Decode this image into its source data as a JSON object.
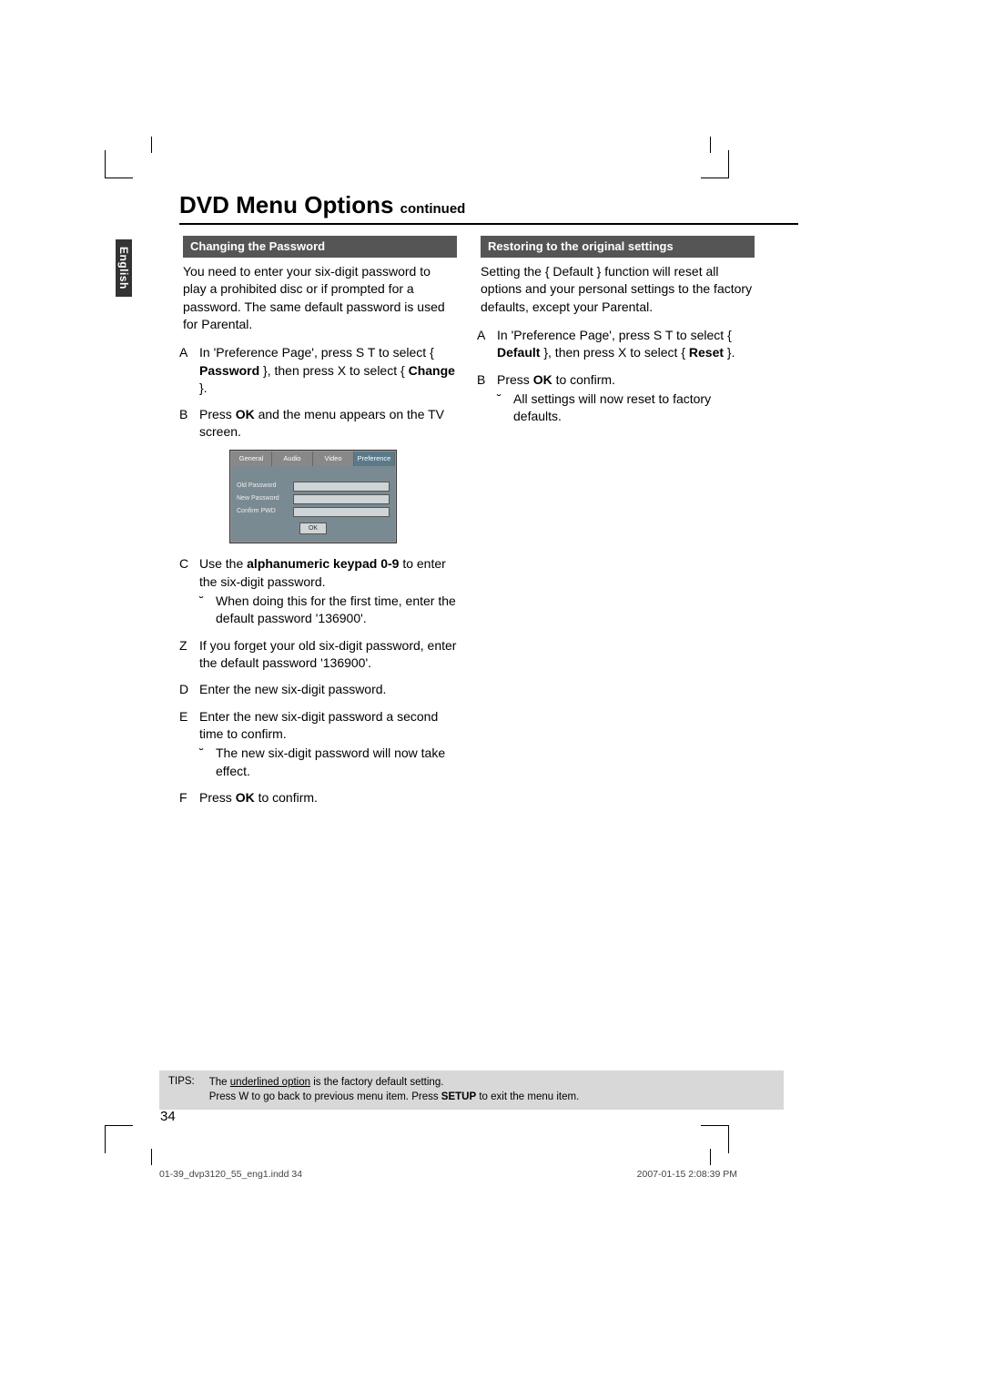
{
  "lang_tab": "English",
  "title_main": "DVD Menu Options",
  "title_sub": "continued",
  "left": {
    "section": "Changing the Password",
    "intro": "You need to enter your six-digit password to play a prohibited disc or if prompted for a password. The same default password is used for Parental.",
    "stepA_pre": "In 'Preference Page', press  S  T  to select { ",
    "stepA_pw": "Password",
    "stepA_mid": " }, then press  X to select { ",
    "stepA_ch": "Change",
    "stepA_post": " }.",
    "stepB_pre": "Press ",
    "stepB_ok": "OK",
    "stepB_post": " and the menu appears on the TV screen.",
    "osd_tabs": {
      "t1": "General",
      "t2": "Audio",
      "t3": "Video",
      "t4": "Preference"
    },
    "osd_rows": {
      "r1": "Old Password",
      "r2": "New Password",
      "r3": "Confirm PWD"
    },
    "osd_ok": "OK",
    "stepC_pre": "Use the ",
    "stepC_bold": "alphanumeric keypad 0-9",
    "stepC_post": " to enter the six-digit password.",
    "stepC_sub": "When doing this for the first time, enter the default password '136900'.",
    "stepZ": "If you forget your old six-digit password, enter the default password '136900'.",
    "stepD": "Enter the new six-digit password.",
    "stepE": "Enter the new six-digit password a second time to confirm.",
    "stepE_sub": "The new six-digit password will now take effect.",
    "stepF_pre": "Press ",
    "stepF_ok": "OK",
    "stepF_post": " to confirm."
  },
  "right": {
    "section": "Restoring to the original settings",
    "intro": "Setting the { Default } function will reset all options and your personal settings to the factory defaults, except your Parental.",
    "stepA_pre": "In 'Preference Page', press  S  T  to select { ",
    "stepA_def": "Default",
    "stepA_mid": " }, then press  X to select { ",
    "stepA_res": "Reset",
    "stepA_post": " }.",
    "stepB_pre": "Press ",
    "stepB_ok": "OK",
    "stepB_post": " to confirm.",
    "stepB_sub": "All settings will now reset to factory defaults."
  },
  "tips": {
    "label": "TIPS:",
    "line1_a": "The ",
    "line1_u": "underlined option",
    "line1_b": " is the factory default setting.",
    "line2_a": "Press  W to go back to previous menu item. Press ",
    "line2_b": "SETUP",
    "line2_c": " to exit the menu item."
  },
  "page_number": "34",
  "footer_left": "01-39_dvp3120_55_eng1.indd   34",
  "footer_right": "2007-01-15   2:08:39 PM"
}
